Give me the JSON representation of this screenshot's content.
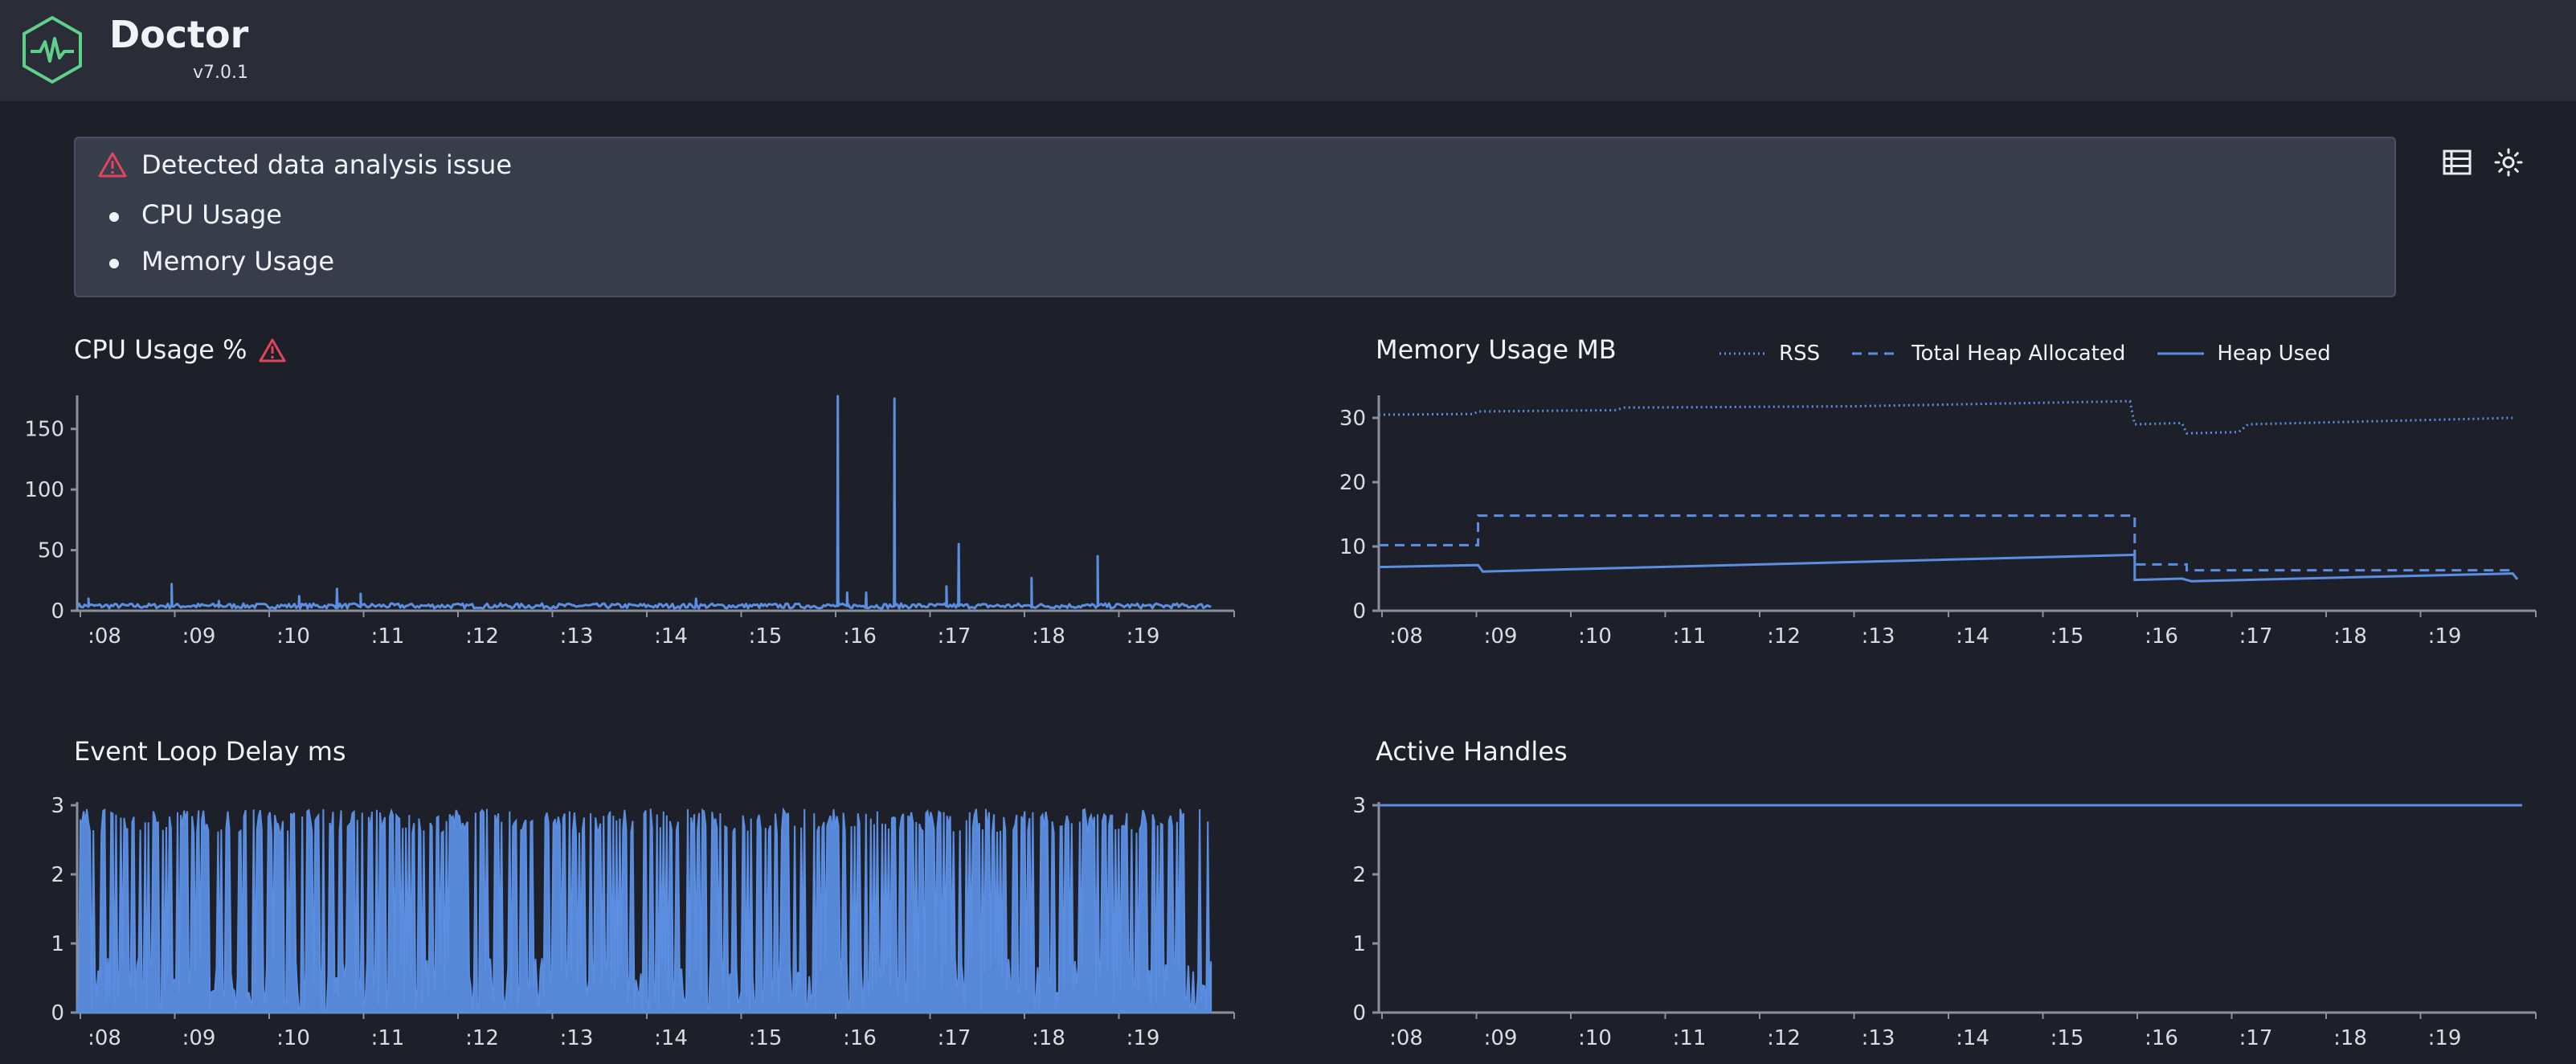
{
  "app": {
    "title": "Doctor",
    "version": "v7.0.1",
    "logo_icon": "heartbeat-hexagon-icon"
  },
  "alert": {
    "icon": "warning-triangle-icon",
    "title": "Detected data analysis issue",
    "items": [
      "CPU Usage",
      "Memory Usage"
    ]
  },
  "toolbar": {
    "list_view_icon": "list-view-icon",
    "theme_icon": "sun-icon"
  },
  "colors": {
    "line": "#5b8ee0",
    "warning": "#e0455c",
    "logo": "#5fd08a",
    "axis": "#8a8f9c"
  },
  "panels": {
    "cpu": {
      "title": "CPU Usage %",
      "warning_icon": "warning-triangle-icon"
    },
    "memory": {
      "title": "Memory Usage MB"
    },
    "eventloop": {
      "title": "Event Loop Delay ms"
    },
    "handles": {
      "title": "Active Handles"
    }
  },
  "chart_data": [
    {
      "id": "cpu",
      "type": "line",
      "title": "CPU Usage %",
      "xlim": [
        0,
        12
      ],
      "ylim": [
        0,
        175
      ],
      "yticks": [
        0,
        50,
        100,
        150
      ],
      "xtick_labels": [
        ":08",
        ":09",
        ":10",
        ":11",
        ":12",
        ":13",
        ":14",
        ":15",
        ":16",
        ":17",
        ":18",
        ":19"
      ],
      "baseline": 4,
      "spikes": [
        {
          "x": 0.12,
          "y": 10
        },
        {
          "x": 1.0,
          "y": 22
        },
        {
          "x": 1.5,
          "y": 8
        },
        {
          "x": 2.35,
          "y": 12
        },
        {
          "x": 2.75,
          "y": 18
        },
        {
          "x": 3.0,
          "y": 14
        },
        {
          "x": 6.55,
          "y": 10
        },
        {
          "x": 8.05,
          "y": 177
        },
        {
          "x": 8.15,
          "y": 15
        },
        {
          "x": 8.35,
          "y": 15
        },
        {
          "x": 8.65,
          "y": 175
        },
        {
          "x": 9.2,
          "y": 20
        },
        {
          "x": 9.33,
          "y": 55
        },
        {
          "x": 10.1,
          "y": 27
        },
        {
          "x": 10.8,
          "y": 45
        }
      ],
      "series": [
        {
          "values_note_free": true
        }
      ]
    },
    {
      "id": "memory",
      "type": "line",
      "title": "Memory Usage MB",
      "xlim": [
        0,
        12
      ],
      "ylim": [
        0,
        33
      ],
      "yticks": [
        0,
        10,
        20,
        30
      ],
      "xtick_labels": [
        ":08",
        ":09",
        ":10",
        ":11",
        ":12",
        ":13",
        ":14",
        ":15",
        ":16",
        ":17",
        ":18",
        ":19"
      ],
      "series": [
        {
          "name": "RSS",
          "style": "dotted",
          "points": [
            [
              0,
              30.5
            ],
            [
              1.0,
              30.6
            ],
            [
              1.05,
              31.0
            ],
            [
              2.5,
              31.2
            ],
            [
              2.6,
              31.6
            ],
            [
              5.0,
              31.8
            ],
            [
              7.95,
              32.6
            ],
            [
              8.0,
              29.0
            ],
            [
              8.5,
              29.2
            ],
            [
              8.55,
              27.6
            ],
            [
              9.1,
              27.8
            ],
            [
              9.2,
              29.0
            ],
            [
              12,
              30.0
            ]
          ]
        },
        {
          "name": "Total Heap Allocated",
          "style": "dashed",
          "points": [
            [
              0,
              10.2
            ],
            [
              1.05,
              10.2
            ],
            [
              1.05,
              14.8
            ],
            [
              8.0,
              14.8
            ],
            [
              8.0,
              7.2
            ],
            [
              8.55,
              7.2
            ],
            [
              8.55,
              6.3
            ],
            [
              12,
              6.3
            ]
          ]
        },
        {
          "name": "Heap Used",
          "style": "solid",
          "points": [
            [
              0,
              6.8
            ],
            [
              1.05,
              7.1
            ],
            [
              1.1,
              6.1
            ],
            [
              8.0,
              8.7
            ],
            [
              8.0,
              4.8
            ],
            [
              8.5,
              5.0
            ],
            [
              8.6,
              4.6
            ],
            [
              12,
              5.8
            ],
            [
              12.05,
              4.9
            ]
          ]
        }
      ]
    },
    {
      "id": "eventloop",
      "type": "area",
      "title": "Event Loop Delay ms",
      "xlim": [
        0,
        12
      ],
      "ylim": [
        0,
        3
      ],
      "yticks": [
        0,
        1,
        2,
        3
      ],
      "xtick_labels": [
        ":08",
        ":09",
        ":10",
        ":11",
        ":12",
        ":13",
        ":14",
        ":15",
        ":16",
        ":17",
        ":18",
        ":19"
      ],
      "series": [
        {
          "range": [
            0,
            2.95
          ]
        }
      ]
    },
    {
      "id": "handles",
      "type": "line",
      "title": "Active Handles",
      "xlim": [
        0,
        12
      ],
      "ylim": [
        0,
        3
      ],
      "yticks": [
        0,
        1,
        2,
        3
      ],
      "xtick_labels": [
        ":08",
        ":09",
        ":10",
        ":11",
        ":12",
        ":13",
        ":14",
        ":15",
        ":16",
        ":17",
        ":18",
        ":19"
      ],
      "series": [
        {
          "points": [
            [
              0,
              3
            ],
            [
              12.1,
              3
            ]
          ]
        }
      ]
    }
  ]
}
